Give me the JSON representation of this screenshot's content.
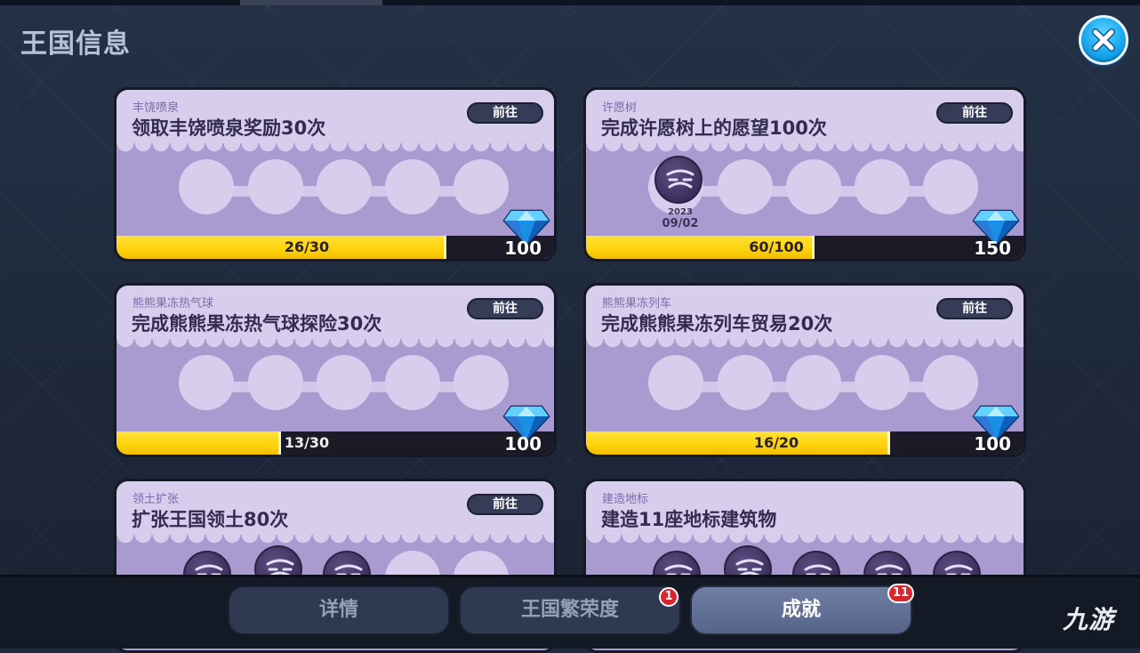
{
  "header": {
    "title": "王国信息"
  },
  "achievements": [
    {
      "category": "丰饶喷泉",
      "task": "领取丰饶喷泉奖励30次",
      "go_label": "前往",
      "progress_text": "26/30",
      "progress": 0.867,
      "reward": "100",
      "stamps": []
    },
    {
      "category": "许愿树",
      "task": "完成许愿树上的愿望100次",
      "go_label": "前往",
      "progress_text": "60/100",
      "progress": 0.6,
      "reward": "150",
      "stamps": [
        {
          "year": "2023",
          "date": "09/02"
        }
      ]
    },
    {
      "category": "熊熊果冻热气球",
      "task": "完成熊熊果冻热气球探险30次",
      "go_label": "前往",
      "progress_text": "13/30",
      "progress": 0.433,
      "reward": "100",
      "stamps": []
    },
    {
      "category": "熊熊果冻列车",
      "task": "完成熊熊果冻列车贸易20次",
      "go_label": "前往",
      "progress_text": "16/20",
      "progress": 0.8,
      "reward": "100",
      "stamps": []
    },
    {
      "category": "领土扩张",
      "task": "扩张王国领土80次",
      "go_label": "前往"
    },
    {
      "category": "建造地标",
      "task": "建造11座地标建筑物"
    }
  ],
  "tabs": [
    {
      "label": "详情",
      "badge": ""
    },
    {
      "label": "王国繁荣度",
      "badge": "1"
    },
    {
      "label": "成就",
      "badge": "11",
      "active": true
    }
  ],
  "watermark": "九游",
  "colors": {
    "progress_fill": "#ffd20a",
    "card_bg": "#a99bd0",
    "card_header": "#d7cdec",
    "close_button": "#18a7ee",
    "badge": "#d8262e"
  },
  "icons": {
    "close": "close-icon",
    "reward": "blue-diamond-icon",
    "stamp": "face-stamp-icon"
  }
}
